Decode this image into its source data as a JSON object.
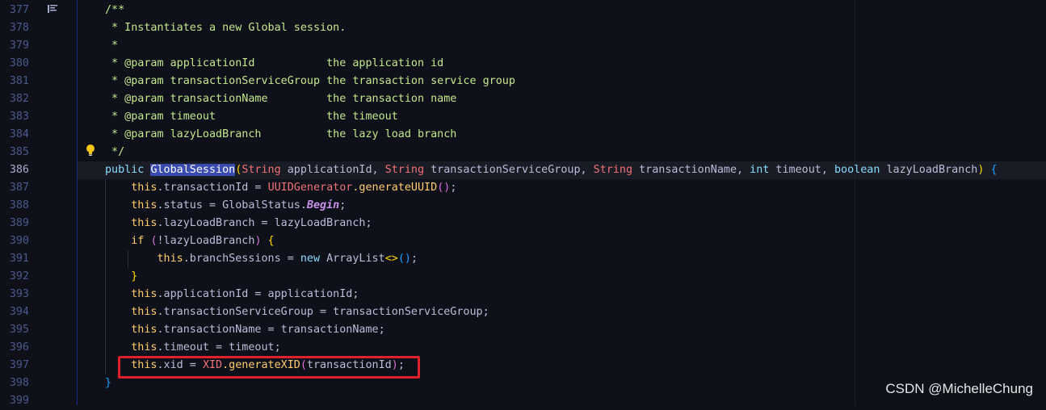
{
  "editor": {
    "lines": [
      {
        "num": "377",
        "segments": [
          {
            "t": "/**",
            "c": "c-comment"
          }
        ]
      },
      {
        "num": "378",
        "segments": [
          {
            "t": " * Instantiates a new Global session.",
            "c": "c-comment"
          }
        ]
      },
      {
        "num": "379",
        "segments": [
          {
            "t": " *",
            "c": "c-comment"
          }
        ]
      },
      {
        "num": "380",
        "segments": [
          {
            "t": " * @param applicationId           the application id",
            "c": "c-comment"
          }
        ]
      },
      {
        "num": "381",
        "segments": [
          {
            "t": " * @param transactionServiceGroup the transaction service group",
            "c": "c-comment"
          }
        ]
      },
      {
        "num": "382",
        "segments": [
          {
            "t": " * @param transactionName         the transaction name",
            "c": "c-comment"
          }
        ]
      },
      {
        "num": "383",
        "segments": [
          {
            "t": " * @param timeout                 the timeout",
            "c": "c-comment"
          }
        ]
      },
      {
        "num": "384",
        "segments": [
          {
            "t": " * @param lazyLoadBranch          the lazy load branch",
            "c": "c-comment"
          }
        ]
      },
      {
        "num": "385",
        "segments": [
          {
            "t": " */",
            "c": "c-comment"
          }
        ]
      },
      {
        "num": "386",
        "current": true,
        "segments": [
          {
            "t": "public ",
            "c": "c-kw2"
          },
          {
            "t": "GlobalSession",
            "c": "c-highlight"
          },
          {
            "t": "(",
            "c": "c-paren1"
          },
          {
            "t": "String",
            "c": "c-string-type"
          },
          {
            "t": " applicationId, ",
            "c": "c-plain"
          },
          {
            "t": "String",
            "c": "c-string-type"
          },
          {
            "t": " transactionServiceGroup, ",
            "c": "c-plain"
          },
          {
            "t": "String",
            "c": "c-string-type"
          },
          {
            "t": " transactionName, ",
            "c": "c-plain"
          },
          {
            "t": "int",
            "c": "c-kw2"
          },
          {
            "t": " timeout, ",
            "c": "c-plain"
          },
          {
            "t": "boolean",
            "c": "c-kw2"
          },
          {
            "t": " lazyLoadBranch",
            "c": "c-plain"
          },
          {
            "t": ")",
            "c": "c-paren1"
          },
          {
            "t": " {",
            "c": "c-paren3"
          }
        ]
      },
      {
        "num": "387",
        "segments": [
          {
            "t": "    this",
            "c": "c-this"
          },
          {
            "t": ".transactionId = ",
            "c": "c-plain"
          },
          {
            "t": "UUIDGenerator",
            "c": "c-type"
          },
          {
            "t": ".generateUUID",
            "c": "c-mname"
          },
          {
            "t": "()",
            "c": "c-paren2"
          },
          {
            "t": ";",
            "c": "c-plain"
          }
        ]
      },
      {
        "num": "388",
        "segments": [
          {
            "t": "    this",
            "c": "c-this"
          },
          {
            "t": ".status = GlobalStatus.",
            "c": "c-plain"
          },
          {
            "t": "Begin",
            "c": "c-const"
          },
          {
            "t": ";",
            "c": "c-plain"
          }
        ]
      },
      {
        "num": "389",
        "segments": [
          {
            "t": "    this",
            "c": "c-this"
          },
          {
            "t": ".lazyLoadBranch = lazyLoadBranch;",
            "c": "c-plain"
          }
        ]
      },
      {
        "num": "390",
        "segments": [
          {
            "t": "    if ",
            "c": "c-this"
          },
          {
            "t": "(",
            "c": "c-paren2"
          },
          {
            "t": "!lazyLoadBranch",
            "c": "c-plain"
          },
          {
            "t": ")",
            "c": "c-paren2"
          },
          {
            "t": " {",
            "c": "c-paren1"
          }
        ]
      },
      {
        "num": "391",
        "segments": [
          {
            "t": "        this",
            "c": "c-this"
          },
          {
            "t": ".branchSessions = ",
            "c": "c-plain"
          },
          {
            "t": "new",
            "c": "c-kw2"
          },
          {
            "t": " ArrayList",
            "c": "c-plain"
          },
          {
            "t": "<>",
            "c": "c-paren1"
          },
          {
            "t": "()",
            "c": "c-paren3"
          },
          {
            "t": ";",
            "c": "c-plain"
          }
        ]
      },
      {
        "num": "392",
        "segments": [
          {
            "t": "    }",
            "c": "c-paren1"
          }
        ]
      },
      {
        "num": "393",
        "segments": [
          {
            "t": "    this",
            "c": "c-this"
          },
          {
            "t": ".applicationId = applicationId;",
            "c": "c-plain"
          }
        ]
      },
      {
        "num": "394",
        "segments": [
          {
            "t": "    this",
            "c": "c-this"
          },
          {
            "t": ".transactionServiceGroup = transactionServiceGroup;",
            "c": "c-plain"
          }
        ]
      },
      {
        "num": "395",
        "segments": [
          {
            "t": "    this",
            "c": "c-this"
          },
          {
            "t": ".transactionName = transactionName;",
            "c": "c-plain"
          }
        ]
      },
      {
        "num": "396",
        "segments": [
          {
            "t": "    this",
            "c": "c-this"
          },
          {
            "t": ".timeout = timeout;",
            "c": "c-plain"
          }
        ]
      },
      {
        "num": "397",
        "segments": [
          {
            "t": "    this",
            "c": "c-this"
          },
          {
            "t": ".xid = ",
            "c": "c-plain"
          },
          {
            "t": "XID",
            "c": "c-type"
          },
          {
            "t": ".generateXID",
            "c": "c-mname"
          },
          {
            "t": "(",
            "c": "c-paren2"
          },
          {
            "t": "transactionId",
            "c": "c-plain"
          },
          {
            "t": ")",
            "c": "c-paren2"
          },
          {
            "t": ";",
            "c": "c-plain"
          }
        ]
      },
      {
        "num": "398",
        "segments": [
          {
            "t": "}",
            "c": "c-paren3"
          }
        ]
      },
      {
        "num": "399",
        "segments": []
      }
    ]
  },
  "icons": {
    "bookmark": "bookmark-icon",
    "bulb": "lightbulb-icon"
  },
  "watermark": "CSDN @MichelleChung",
  "colors": {
    "background": "#0f111a",
    "highlight_box": "#e0202a"
  }
}
